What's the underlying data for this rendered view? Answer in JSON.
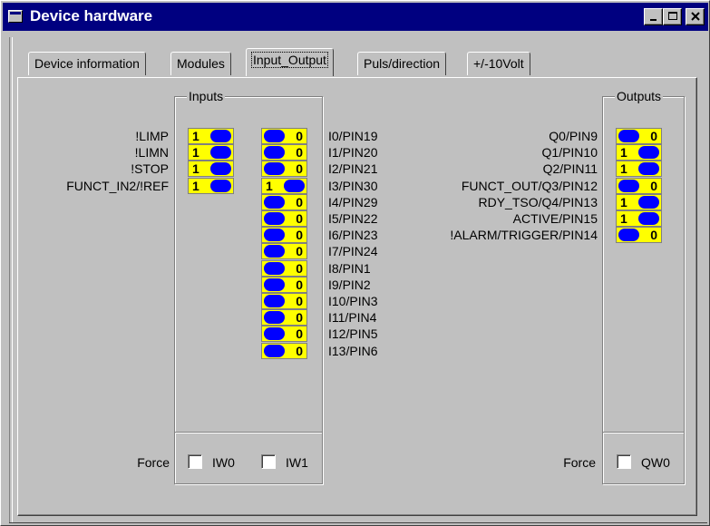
{
  "window": {
    "title": "Device hardware"
  },
  "tabs": [
    {
      "label": "Device information"
    },
    {
      "label": "Modules"
    },
    {
      "label": "Input_Output"
    },
    {
      "label": "Puls/direction"
    },
    {
      "label": "+/-10Volt"
    }
  ],
  "inputs": {
    "title": "Inputs",
    "left": [
      {
        "label": "!LIMP",
        "value": "1"
      },
      {
        "label": "!LIMN",
        "value": "1"
      },
      {
        "label": "!STOP",
        "value": "1"
      },
      {
        "label": "FUNCT_IN2/!REF",
        "value": "1"
      }
    ],
    "right": [
      {
        "label": "I0/PIN19",
        "value": "0"
      },
      {
        "label": "I1/PIN20",
        "value": "0"
      },
      {
        "label": "I2/PIN21",
        "value": "0"
      },
      {
        "label": "I3/PIN30",
        "value": "1"
      },
      {
        "label": "I4/PIN29",
        "value": "0"
      },
      {
        "label": "I5/PIN22",
        "value": "0"
      },
      {
        "label": "I6/PIN23",
        "value": "0"
      },
      {
        "label": "I7/PIN24",
        "value": "0"
      },
      {
        "label": "I8/PIN1",
        "value": "0"
      },
      {
        "label": "I9/PIN2",
        "value": "0"
      },
      {
        "label": "I10/PIN3",
        "value": "0"
      },
      {
        "label": "I11/PIN4",
        "value": "0"
      },
      {
        "label": "I12/PIN5",
        "value": "0"
      },
      {
        "label": "I13/PIN6",
        "value": "0"
      }
    ],
    "force_label": "Force",
    "force_checks": [
      {
        "label": "IW0",
        "checked": false
      },
      {
        "label": "IW1",
        "checked": false
      }
    ]
  },
  "outputs": {
    "title": "Outputs",
    "items": [
      {
        "label": "Q0/PIN9",
        "value": "0"
      },
      {
        "label": "Q1/PIN10",
        "value": "1"
      },
      {
        "label": "Q2/PIN11",
        "value": "1"
      },
      {
        "label": "FUNCT_OUT/Q3/PIN12",
        "value": "0"
      },
      {
        "label": "RDY_TSO/Q4/PIN13",
        "value": "1"
      },
      {
        "label": "ACTIVE/PIN15",
        "value": "1"
      },
      {
        "label": "!ALARM/TRIGGER/PIN14",
        "value": "0"
      }
    ],
    "force_label": "Force",
    "force_checks": [
      {
        "label": "QW0",
        "checked": false
      }
    ]
  },
  "colors": {
    "titlebar": "#000080",
    "indicator_bg": "#ffff00",
    "led": "#0000ff",
    "face": "#c0c0c0"
  }
}
